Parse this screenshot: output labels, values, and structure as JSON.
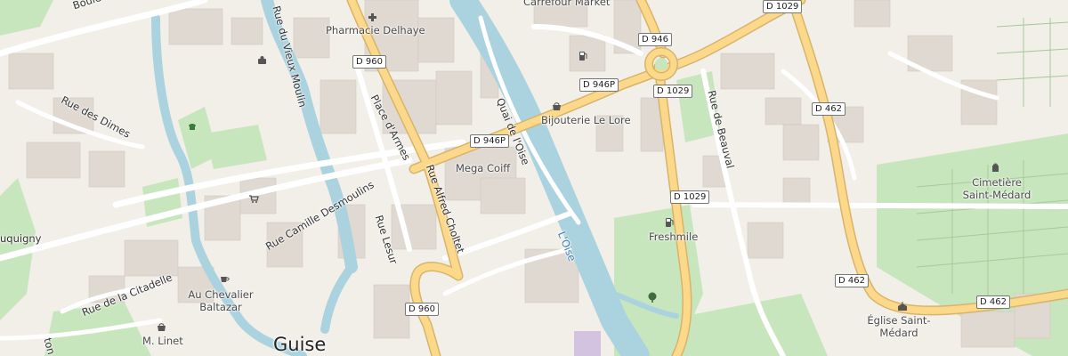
{
  "map": {
    "colors": {
      "background": "#f2efe9",
      "building": "#dfd9d2",
      "park": "#c8e6bd",
      "water": "#aad3df",
      "primary_road": "#fcd88a",
      "road_casing": "#d7b46a",
      "minor_road": "#ffffff"
    },
    "city": {
      "name": "Guise"
    },
    "streets": {
      "boulevard_pequereau": "Boulevard Pequereau",
      "rue_du_vieux_moulin": "Rue du Vieux Moulin",
      "rue_des_dimes": "Rue des Dimes",
      "place_d_armes": "Place d'Armes",
      "quai_de_l_oise": "Quai de l'Oise",
      "rue_alfred_choltet": "Rue Alfred Choltet",
      "rue_camille_desmoulins": "Rue Camille Desmoulins",
      "rue_lesur": "Rue Lesur",
      "rue_de_la_citadelle": "Rue de la Citadelle",
      "rue_de_beauval": "Rue de Beauval",
      "uquigny": "uquigny",
      "ton": "ton"
    },
    "waterways": {
      "oise": "L'Oise"
    },
    "road_refs": {
      "d960_a": "D 960",
      "d946": "D 946",
      "d1029_a": "D 1029",
      "d946p_a": "D 946P",
      "d1029_b": "D 1029",
      "d462_a": "D 462",
      "d946p_b": "D 946P",
      "d1029_c": "D 1029",
      "d462_b": "D 462",
      "d462_c": "D 462",
      "d960_b": "D 960"
    },
    "pois": {
      "carrefour": {
        "name": "Carrefour Market",
        "icon": "shop-icon"
      },
      "pharmacie": {
        "name": "Pharmacie Delhaye",
        "icon": "pharmacy-icon"
      },
      "bijouterie": {
        "name": "Bijouterie Le Lore",
        "icon": "jewelry-icon"
      },
      "mega_coiff": {
        "name": "Mega Coiff",
        "icon": "hairdresser-icon"
      },
      "freshmile": {
        "name": "Freshmile",
        "icon": "fuel-icon"
      },
      "cimetiere": {
        "name": "Cimetière Saint-Médard",
        "icon": "cemetery-icon"
      },
      "eglise": {
        "name": "Église Saint-Médard",
        "icon": "church-icon"
      },
      "chevalier": {
        "name": "Au Chevalier Baltazar",
        "icon": "cafe-icon"
      },
      "linet": {
        "name": "M. Linet",
        "icon": "shop-icon"
      }
    },
    "icons": {
      "fuel_top": "fuel-icon",
      "supermarket": "supermarket-icon",
      "playground": "playground-icon",
      "tree": "tree-icon",
      "bus": "bus-icon"
    }
  }
}
